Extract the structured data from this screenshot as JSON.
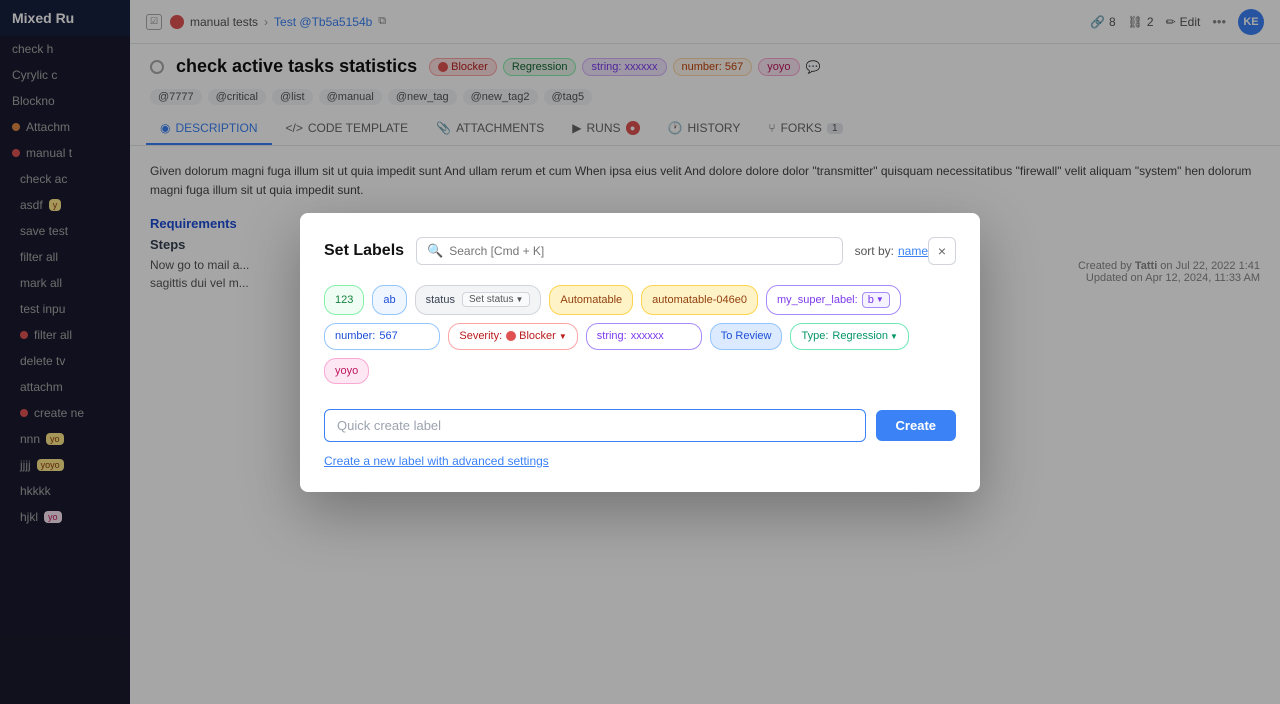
{
  "app_title": "Mixed Ru",
  "sidebar": {
    "items": [
      {
        "label": "check h",
        "dot": "none"
      },
      {
        "label": "Cyrylic c",
        "dot": "none"
      },
      {
        "label": "Blockno",
        "dot": "none"
      },
      {
        "label": "Attachm",
        "dot": "orange"
      },
      {
        "label": "manual t",
        "dot": "red"
      },
      {
        "label": "check ac",
        "dot": "none"
      },
      {
        "label": "asdf",
        "dot": "none"
      },
      {
        "label": "save test",
        "dot": "none"
      },
      {
        "label": "filter all",
        "dot": "none"
      },
      {
        "label": "mark all",
        "dot": "none"
      },
      {
        "label": "test inpu",
        "dot": "none"
      },
      {
        "label": "filter all",
        "dot": "red"
      },
      {
        "label": "delete tv",
        "dot": "none"
      },
      {
        "label": "attachm",
        "dot": "none"
      },
      {
        "label": "create ne",
        "dot": "red"
      },
      {
        "label": "nnn",
        "dot": "none"
      },
      {
        "label": "jjjj",
        "dot": "none"
      },
      {
        "label": "hkkkk",
        "dot": "none"
      },
      {
        "label": "hjkl",
        "dot": "none"
      }
    ]
  },
  "topbar": {
    "breadcrumb1": "manual tests",
    "breadcrumb2": "Test @Tb5a5154b",
    "edit_label": "Edit",
    "link_count": "8",
    "ref_count": "2",
    "avatar": "KE"
  },
  "issue": {
    "title": "check active tasks statistics",
    "labels": {
      "blocker": "Blocker",
      "regression": "Regression",
      "string": "string: xxxxxx",
      "number": "number: 567",
      "yoyo": "yoyo"
    }
  },
  "tags": [
    "@7777",
    "@critical",
    "@list",
    "@manual",
    "@new_tag",
    "@new_tag2",
    "@tag5"
  ],
  "tabs": [
    {
      "label": "DESCRIPTION",
      "icon": "description-icon",
      "active": true
    },
    {
      "label": "CODE TEMPLATE",
      "icon": "code-icon",
      "active": false
    },
    {
      "label": "ATTACHMENTS",
      "icon": "attachment-icon",
      "active": false
    },
    {
      "label": "RUNS",
      "icon": "runs-icon",
      "active": false,
      "badge": "●"
    },
    {
      "label": "HISTORY",
      "icon": "history-icon",
      "active": false
    },
    {
      "label": "FORKS",
      "icon": "forks-icon",
      "active": false,
      "count": "1"
    }
  ],
  "content_text": "Given dolorum magni fuga illum sit ut quia impedit sunt And ullam rerum et cum When ipsa eius velit And dolore dolore dolor \"transmitter\" quisquam necessitatibus \"firewall\" velit aliquam \"system\" hen dolorum magni fuga illum sit ut quia impedit sunt.",
  "requirements_title": "Requirements",
  "steps_title": "Steps",
  "step1": "Now go to mail a...",
  "step2": "sagittis dui vel m...",
  "modal": {
    "title": "Set Labels",
    "search_placeholder": "Search [Cmd + K]",
    "sort_label": "sort by:",
    "sort_value": "name",
    "close_label": "×",
    "labels": [
      {
        "id": "label-123",
        "text": "123",
        "type": "plain-green"
      },
      {
        "id": "label-ab",
        "text": "ab",
        "type": "plain-blue"
      },
      {
        "id": "label-status",
        "text": "status",
        "type": "status",
        "has_select": true,
        "select_value": "Set status"
      },
      {
        "id": "label-automatable",
        "text": "Automatable",
        "type": "automatable"
      },
      {
        "id": "label-automatable2",
        "text": "automatable-046e0",
        "type": "automatable2"
      },
      {
        "id": "label-super",
        "text": "my_super_label:",
        "value": "b",
        "type": "super",
        "has_select": true
      },
      {
        "id": "label-number",
        "text": "number:",
        "value": "567",
        "type": "number"
      },
      {
        "id": "label-severity",
        "text": "Severity:",
        "value": "Blocker",
        "type": "severity",
        "has_select": true
      },
      {
        "id": "label-string",
        "text": "string:",
        "value": "xxxxxx",
        "type": "string"
      },
      {
        "id": "label-toreview",
        "text": "To Review",
        "type": "toreview"
      },
      {
        "id": "label-type",
        "text": "Type:",
        "value": "Regression",
        "type": "type",
        "has_select": true
      },
      {
        "id": "label-yoyo",
        "text": "yoyo",
        "type": "yoyo-pill"
      }
    ],
    "quick_create_placeholder": "Quick create label",
    "create_btn": "Create",
    "advanced_link": "Create a new label with advanced settings"
  }
}
